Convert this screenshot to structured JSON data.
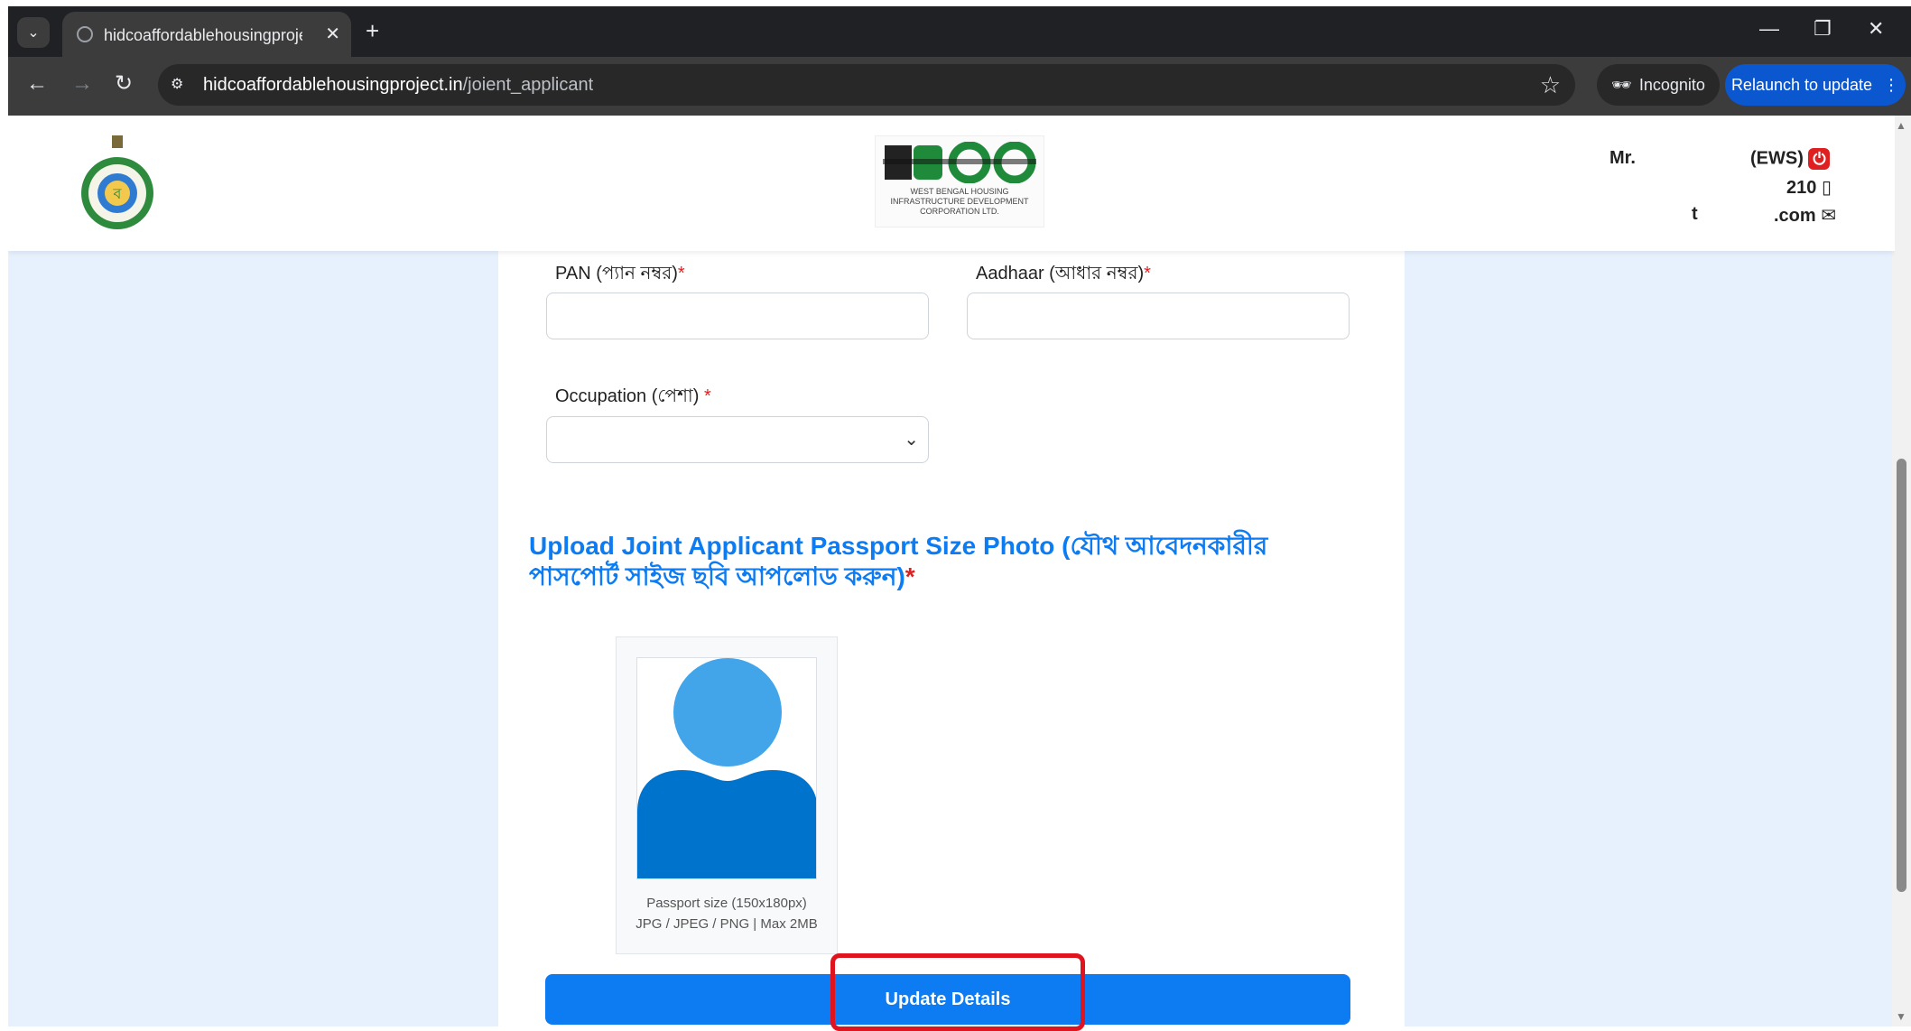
{
  "browser": {
    "tab_title": "hidcoaffordablehousingproject.",
    "tab_close": "✕",
    "new_tab": "+",
    "url_domain": "hidcoaffordablehousingproject.in",
    "url_path": "/joient_applicant",
    "incognito_label": "Incognito",
    "relaunch_label": "Relaunch to update",
    "minimize": "—",
    "restore": "❐",
    "close": "✕"
  },
  "header": {
    "logo_sub": "WEST BENGAL HOUSING INFRASTRUCTURE DEVELOPMENT CORPORATION LTD.",
    "user": {
      "salutation": "Mr.",
      "category": "(EWS)",
      "phone": "210",
      "email_start": "t",
      "email_end": ".com"
    }
  },
  "form": {
    "pan_label": "PAN (প্যান নম্বর)",
    "aadhaar_label": "Aadhaar (আধার নম্বর)",
    "occupation_label": "Occupation (পেশা)",
    "required_mark": "*",
    "upload_title": "Upload Joint Applicant Passport Size Photo (যৌথ আবেদনকারীর পাসপোর্ট সাইজ ছবি আপলোড করুন)",
    "photo_caption_1": "Passport size (150x180px)",
    "photo_caption_2": "JPG / JPEG / PNG | Max 2MB",
    "update_button": "Update Details"
  },
  "colors": {
    "accent": "#0d7cf2",
    "required": "#e02020",
    "highlight": "#e0141e",
    "page_bg": "#e7f1fd"
  }
}
